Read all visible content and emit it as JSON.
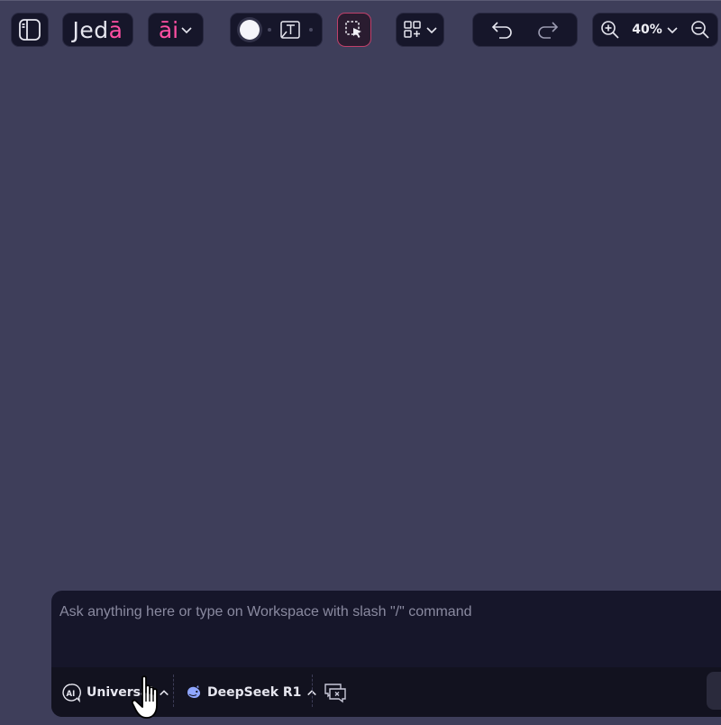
{
  "toolbar": {
    "logo": {
      "main": "Jed",
      "accent": "ā"
    },
    "ai_menu": {
      "label": "āi"
    },
    "zoom": {
      "level": "40%"
    }
  },
  "chat": {
    "placeholder": "Ask anything here or type on Workspace with slash \"/\" command",
    "assistant_mode": "Universal",
    "model": "DeepSeek R1"
  },
  "colors": {
    "canvas_bg": "#3e3e5a",
    "panel_bg": "#16162a",
    "brand_accent": "#ff4fa3",
    "active_tool_border": "#c0406a"
  },
  "icons": [
    "sidebar-toggle-icon",
    "chevron-down-icon",
    "theme-toggle-icon",
    "text-frame-icon",
    "select-tool-icon",
    "add-widget-icon",
    "undo-icon",
    "redo-icon",
    "zoom-in-icon",
    "zoom-out-icon",
    "ai-mode-icon",
    "chevron-up-icon",
    "deepseek-whale-icon",
    "clear-chat-icon",
    "pointer-hand-icon"
  ]
}
